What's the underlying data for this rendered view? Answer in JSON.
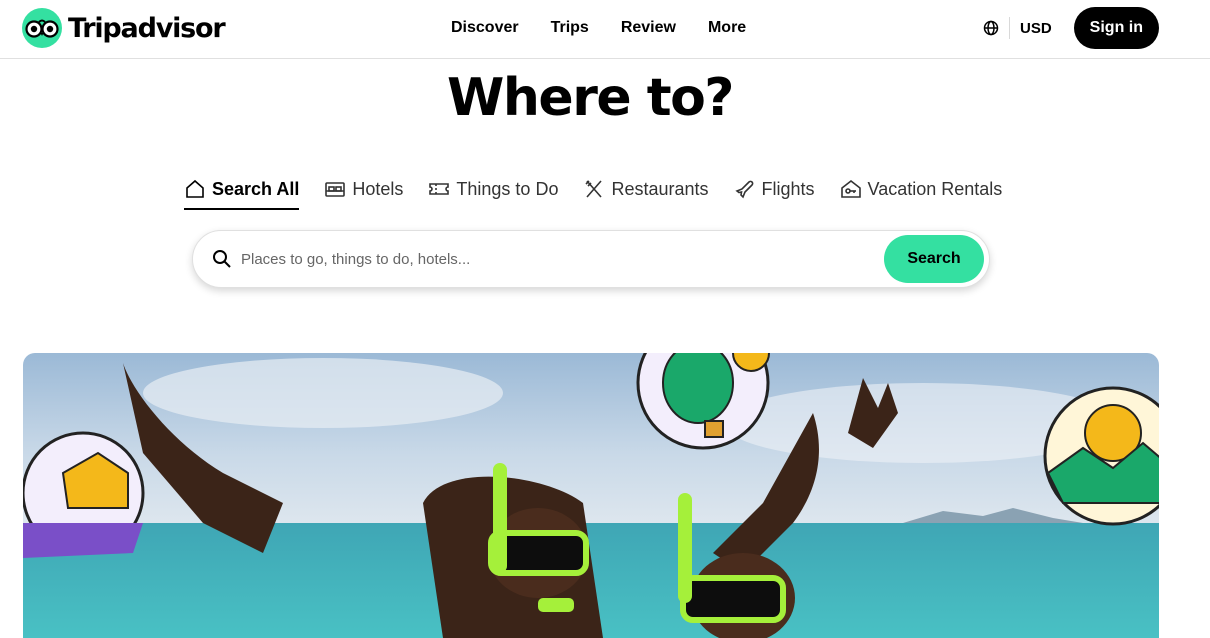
{
  "header": {
    "brand": "Tripadvisor",
    "nav": [
      "Discover",
      "Trips",
      "Review",
      "More"
    ],
    "currency": "USD",
    "signin_label": "Sign in"
  },
  "hero": {
    "title": "Where to?"
  },
  "tabs": [
    {
      "label": "Search All",
      "icon": "home-icon",
      "active": true
    },
    {
      "label": "Hotels",
      "icon": "bed-icon",
      "active": false
    },
    {
      "label": "Things to Do",
      "icon": "ticket-icon",
      "active": false
    },
    {
      "label": "Restaurants",
      "icon": "utensils-icon",
      "active": false
    },
    {
      "label": "Flights",
      "icon": "plane-icon",
      "active": false
    },
    {
      "label": "Vacation Rentals",
      "icon": "house-key-icon",
      "active": false
    }
  ],
  "search": {
    "placeholder": "Places to go, things to do, hotels...",
    "button_label": "Search"
  },
  "colors": {
    "brand_green": "#34e0a1",
    "black": "#000000"
  }
}
